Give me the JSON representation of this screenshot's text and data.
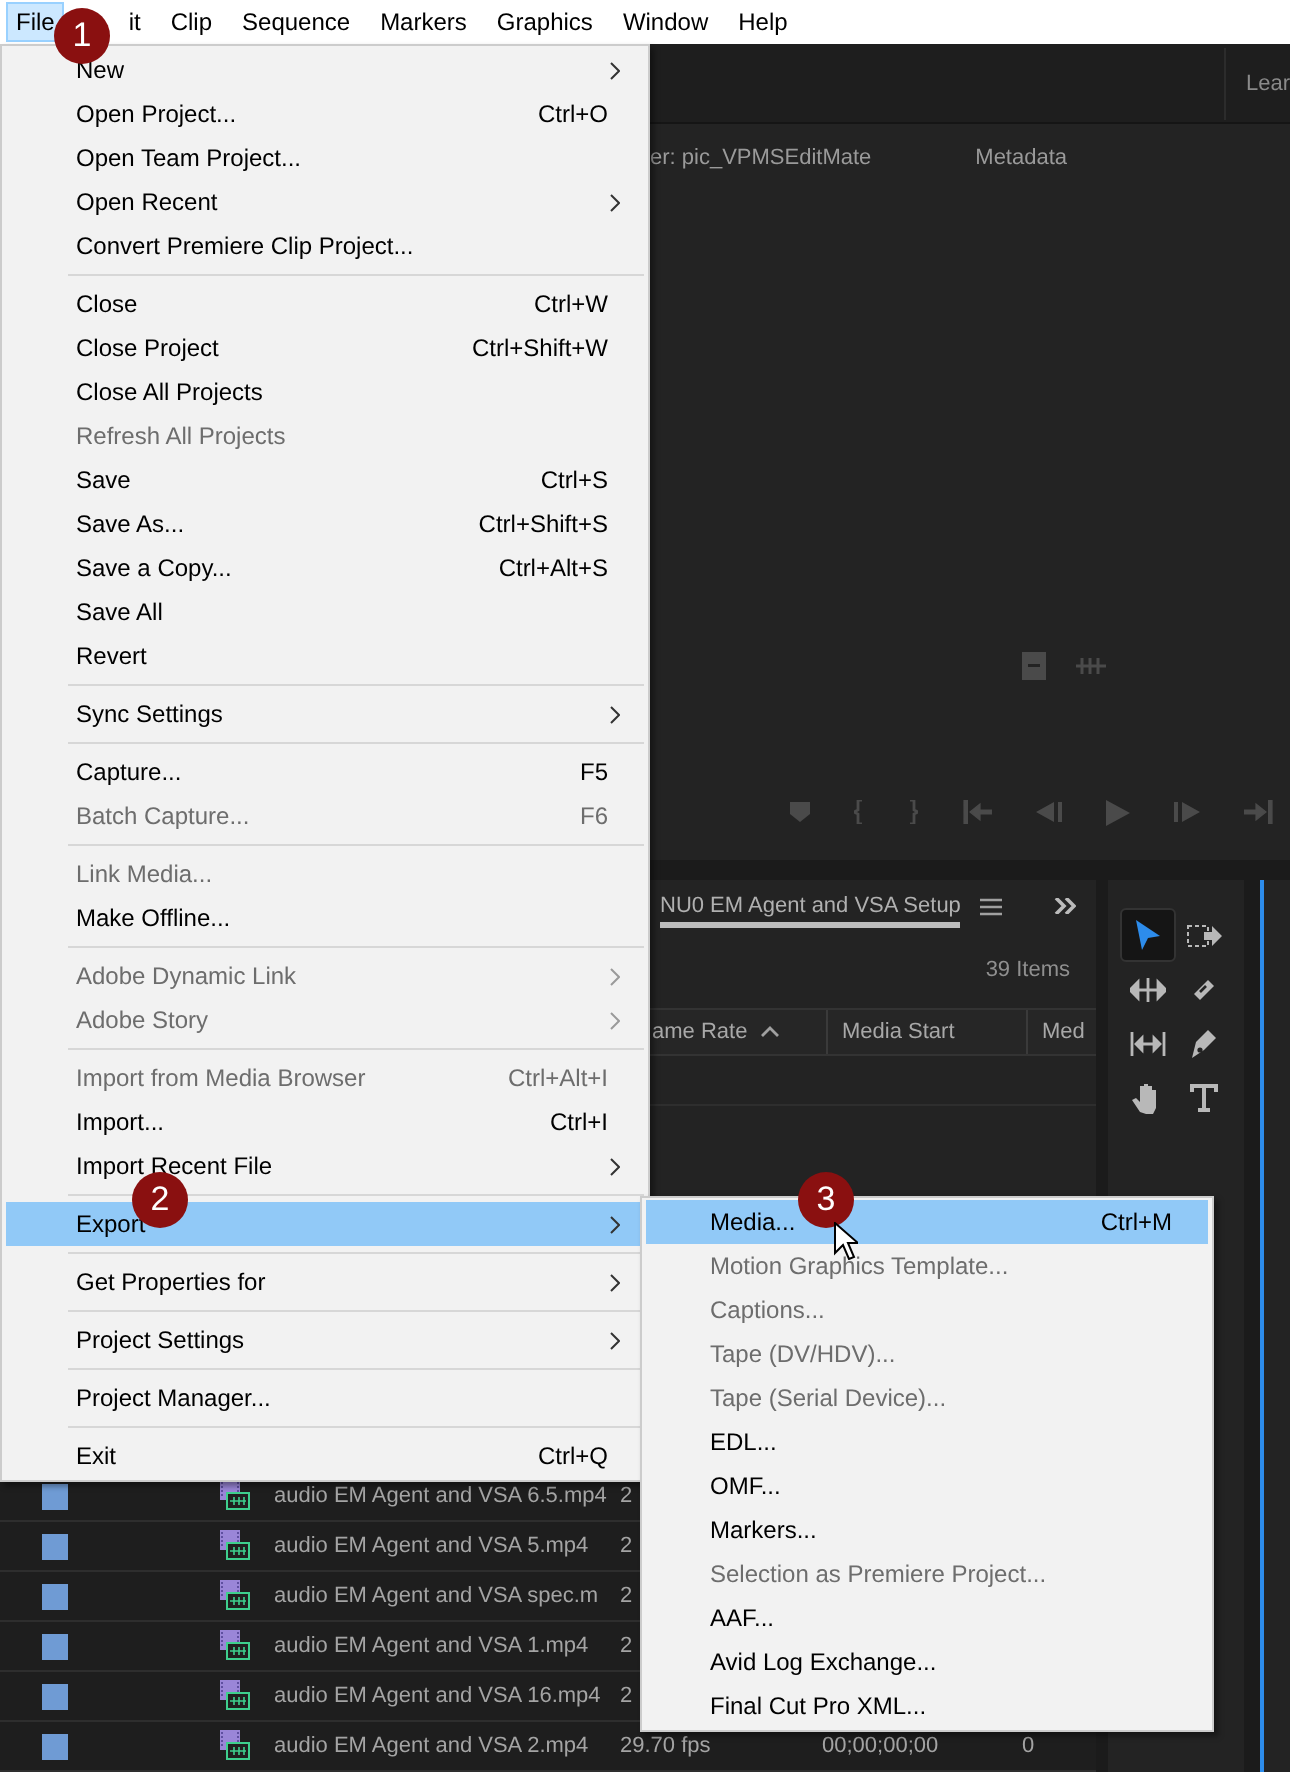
{
  "menubar": [
    {
      "label": "File",
      "selected": true
    },
    {
      "label": "it",
      "selected": false
    },
    {
      "label": "Clip",
      "selected": false
    },
    {
      "label": "Sequence",
      "selected": false
    },
    {
      "label": "Markers",
      "selected": false
    },
    {
      "label": "Graphics",
      "selected": false
    },
    {
      "label": "Window",
      "selected": false
    },
    {
      "label": "Help",
      "selected": false
    }
  ],
  "workspace_tab": "Lear",
  "source_monitor": {
    "tabs": [
      "er: pic_VPMSEditMate",
      "Metadata"
    ]
  },
  "project_panel": {
    "tab": "NU0 EM Agent and VSA Setup",
    "item_count": "39 Items",
    "columns": [
      {
        "label": "ame Rate",
        "sorted": true
      },
      {
        "label": "Media Start",
        "sorted": false
      },
      {
        "label": "Med",
        "sorted": false
      }
    ],
    "rows": [
      {
        "name": "audio EM Agent and VSA 6.5.mp4",
        "frame_rate": "2"
      },
      {
        "name": "audio EM Agent and VSA 5.mp4",
        "frame_rate": "2"
      },
      {
        "name": "audio EM Agent and VSA spec.m",
        "frame_rate": "2"
      },
      {
        "name": "audio EM Agent and VSA 1.mp4",
        "frame_rate": "2"
      },
      {
        "name": "audio EM Agent and VSA 16.mp4",
        "frame_rate": "2"
      },
      {
        "name": "audio EM Agent and VSA 2.mp4",
        "frame_rate": "29.70 fps",
        "media_start": "00;00;00;00",
        "column_4": "0"
      }
    ]
  },
  "tools": [
    {
      "kind": "selection",
      "selected": true
    },
    {
      "kind": "track_select",
      "selected": false
    },
    {
      "kind": "ripple",
      "selected": false
    },
    {
      "kind": "razor",
      "selected": false
    },
    {
      "kind": "slip",
      "selected": false
    },
    {
      "kind": "pen",
      "selected": false
    },
    {
      "kind": "hand",
      "selected": false
    },
    {
      "kind": "type",
      "selected": false
    }
  ],
  "file_menu": {
    "groups": [
      [
        {
          "label": "New",
          "submenu": true,
          "disabled": false,
          "selected": false
        },
        {
          "label": "Open Project...",
          "shortcut": "Ctrl+O",
          "submenu": false,
          "disabled": false,
          "selected": false
        },
        {
          "label": "Open Team Project...",
          "submenu": false,
          "disabled": false,
          "selected": false
        },
        {
          "label": "Open Recent",
          "submenu": true,
          "disabled": false,
          "selected": false
        },
        {
          "label": "Convert Premiere Clip Project...",
          "submenu": false,
          "disabled": false,
          "selected": false
        }
      ],
      [
        {
          "label": "Close",
          "shortcut": "Ctrl+W",
          "submenu": false,
          "disabled": false,
          "selected": false
        },
        {
          "label": "Close Project",
          "shortcut": "Ctrl+Shift+W",
          "submenu": false,
          "disabled": false,
          "selected": false
        },
        {
          "label": "Close All Projects",
          "submenu": false,
          "disabled": false,
          "selected": false
        },
        {
          "label": "Refresh All Projects",
          "submenu": false,
          "disabled": true,
          "selected": false
        },
        {
          "label": "Save",
          "shortcut": "Ctrl+S",
          "submenu": false,
          "disabled": false,
          "selected": false
        },
        {
          "label": "Save As...",
          "shortcut": "Ctrl+Shift+S",
          "submenu": false,
          "disabled": false,
          "selected": false
        },
        {
          "label": "Save a Copy...",
          "shortcut": "Ctrl+Alt+S",
          "submenu": false,
          "disabled": false,
          "selected": false
        },
        {
          "label": "Save All",
          "submenu": false,
          "disabled": false,
          "selected": false
        },
        {
          "label": "Revert",
          "submenu": false,
          "disabled": false,
          "selected": false
        }
      ],
      [
        {
          "label": "Sync Settings",
          "submenu": true,
          "disabled": false,
          "selected": false
        }
      ],
      [
        {
          "label": "Capture...",
          "shortcut": "F5",
          "submenu": false,
          "disabled": false,
          "selected": false
        },
        {
          "label": "Batch Capture...",
          "shortcut": "F6",
          "submenu": false,
          "disabled": true,
          "selected": false
        }
      ],
      [
        {
          "label": "Link Media...",
          "submenu": false,
          "disabled": true,
          "selected": false
        },
        {
          "label": "Make Offline...",
          "submenu": false,
          "disabled": false,
          "selected": false
        }
      ],
      [
        {
          "label": "Adobe Dynamic Link",
          "submenu": true,
          "disabled": true,
          "selected": false
        },
        {
          "label": "Adobe Story",
          "submenu": true,
          "disabled": true,
          "selected": false
        }
      ],
      [
        {
          "label": "Import from Media Browser",
          "shortcut": "Ctrl+Alt+I",
          "submenu": false,
          "disabled": true,
          "selected": false
        },
        {
          "label": "Import...",
          "shortcut": "Ctrl+I",
          "submenu": false,
          "disabled": false,
          "selected": false
        },
        {
          "label": "Import Recent File",
          "submenu": true,
          "disabled": false,
          "selected": false
        }
      ],
      [
        {
          "label": "Export",
          "submenu": true,
          "disabled": false,
          "selected": true
        }
      ],
      [
        {
          "label": "Get Properties for",
          "submenu": true,
          "disabled": false,
          "selected": false
        }
      ],
      [
        {
          "label": "Project Settings",
          "submenu": true,
          "disabled": false,
          "selected": false
        }
      ],
      [
        {
          "label": "Project Manager...",
          "submenu": false,
          "disabled": false,
          "selected": false
        }
      ],
      [
        {
          "label": "Exit",
          "shortcut": "Ctrl+Q",
          "submenu": false,
          "disabled": false,
          "selected": false
        }
      ]
    ]
  },
  "export_submenu": [
    {
      "label": "Media...",
      "shortcut": "Ctrl+M",
      "disabled": false,
      "selected": true
    },
    {
      "label": "Motion Graphics Template...",
      "disabled": true,
      "selected": false
    },
    {
      "label": "Captions...",
      "disabled": true,
      "selected": false
    },
    {
      "label": "Tape (DV/HDV)...",
      "disabled": true,
      "selected": false
    },
    {
      "label": "Tape (Serial Device)...",
      "disabled": true,
      "selected": false
    },
    {
      "label": "EDL...",
      "disabled": false,
      "selected": false
    },
    {
      "label": "OMF...",
      "disabled": false,
      "selected": false
    },
    {
      "label": "Markers...",
      "disabled": false,
      "selected": false
    },
    {
      "label": "Selection as Premiere Project...",
      "disabled": true,
      "selected": false
    },
    {
      "label": "AAF...",
      "disabled": false,
      "selected": false
    },
    {
      "label": "Avid Log Exchange...",
      "disabled": false,
      "selected": false
    },
    {
      "label": "Final Cut Pro XML...",
      "disabled": false,
      "selected": false
    }
  ],
  "callouts": [
    "1",
    "2",
    "3"
  ]
}
